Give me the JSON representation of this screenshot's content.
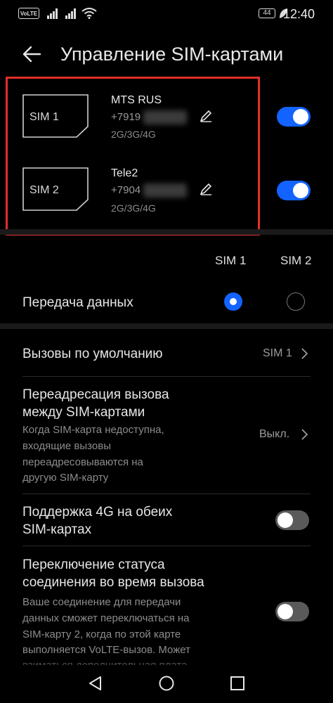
{
  "status_bar": {
    "volte": "VoLTE",
    "battery": "44",
    "time": "12:40"
  },
  "header": {
    "title": "Управление SIM-картами"
  },
  "sims": [
    {
      "slot_label": "SIM 1",
      "operator": "MTS RUS",
      "number": "+7919",
      "tech": "2G/3G/4G",
      "enabled": true
    },
    {
      "slot_label": "SIM 2",
      "operator": "Tele2",
      "number": "+7904",
      "tech": "2G/3G/4G",
      "enabled": true
    }
  ],
  "columns": {
    "sim1": "SIM 1",
    "sim2": "SIM 2"
  },
  "data_transfer": {
    "label": "Передача данных",
    "selected": "SIM 1"
  },
  "default_calls": {
    "label": "Вызовы по умолчанию",
    "value": "SIM 1"
  },
  "call_forwarding": {
    "title": "Переадресация вызова между SIM-картами",
    "line1": "Переадресация вызова",
    "line2": "между SIM-картами",
    "sub": [
      "Когда SIM-карта недоступна,",
      "входящие вызовы",
      "переадресовываются на",
      "другую SIM-карту"
    ],
    "value": "Выкл."
  },
  "dual_4g": {
    "line1": "Поддержка 4G на обеих",
    "line2": "SIM-картах",
    "enabled": false
  },
  "switch_during_call": {
    "line1": "Переключение статуса",
    "line2": "соединения во время вызова",
    "sub": [
      "Ваше соединение для передачи",
      "данных сможет переключаться на",
      "SIM-карту 2, когда по этой карте",
      "выполняется VoLTE-вызов. Может",
      "взиматься дополнительная плата"
    ],
    "enabled": false
  },
  "icons": {
    "back": "arrow-left",
    "edit": "pencil",
    "chevron": "chevron-right",
    "nav_back": "triangle",
    "nav_home": "circle",
    "nav_recent": "square"
  },
  "colors": {
    "accent": "#1263ff",
    "highlight": "#e0302a",
    "background": "#000000"
  }
}
